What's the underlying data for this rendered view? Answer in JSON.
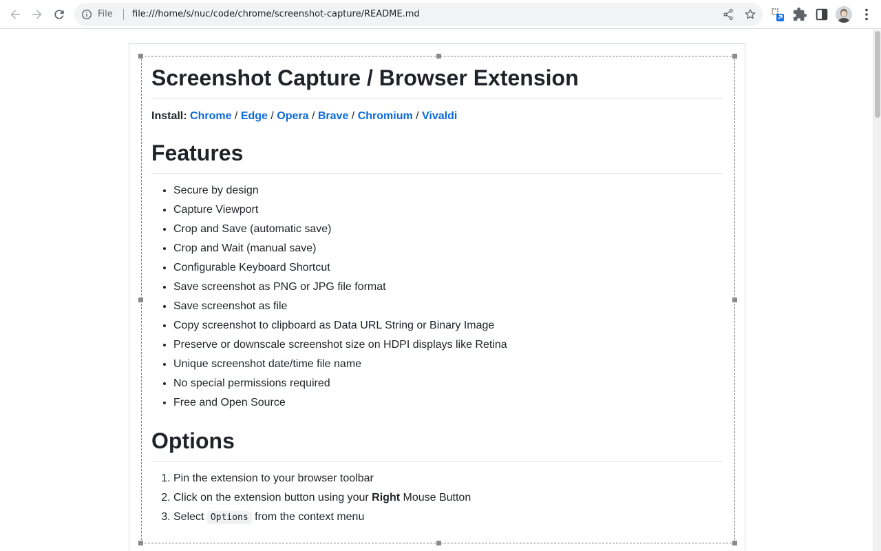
{
  "browser": {
    "scheme_label": "File",
    "url": "file:///home/s/nuc/code/chrome/screenshot-capture/README.md"
  },
  "doc": {
    "title": "Screenshot Capture / Browser Extension",
    "install_label": "Install:",
    "install_links": [
      "Chrome",
      "Edge",
      "Opera",
      "Brave",
      "Chromium",
      "Vivaldi"
    ],
    "features_heading": "Features",
    "features": [
      "Secure by design",
      "Capture Viewport",
      "Crop and Save (automatic save)",
      "Crop and Wait (manual save)",
      "Configurable Keyboard Shortcut",
      "Save screenshot as PNG or JPG file format",
      "Save screenshot as file",
      "Copy screenshot to clipboard as Data URL String or Binary Image",
      "Preserve or downscale screenshot size on HDPI displays like Retina",
      "Unique screenshot date/time file name",
      "No special permissions required",
      "Free and Open Source"
    ],
    "options_heading": "Options",
    "options": {
      "step1": "Pin the extension to your browser toolbar",
      "step2_pre": "Click on the extension button using your ",
      "step2_bold": "Right",
      "step2_post": " Mouse Button",
      "step3_pre": "Select ",
      "step3_code": "Options",
      "step3_post": " from the context menu"
    }
  },
  "colors": {
    "link": "#0969da",
    "text": "#1f2328",
    "extension_badge": "#1a73e8"
  },
  "icons": [
    "back-icon",
    "forward-icon",
    "reload-icon",
    "info-icon",
    "share-icon",
    "star-icon",
    "screenshot-extension-icon",
    "puzzle-icon",
    "side-panel-icon",
    "avatar",
    "more-icon"
  ]
}
